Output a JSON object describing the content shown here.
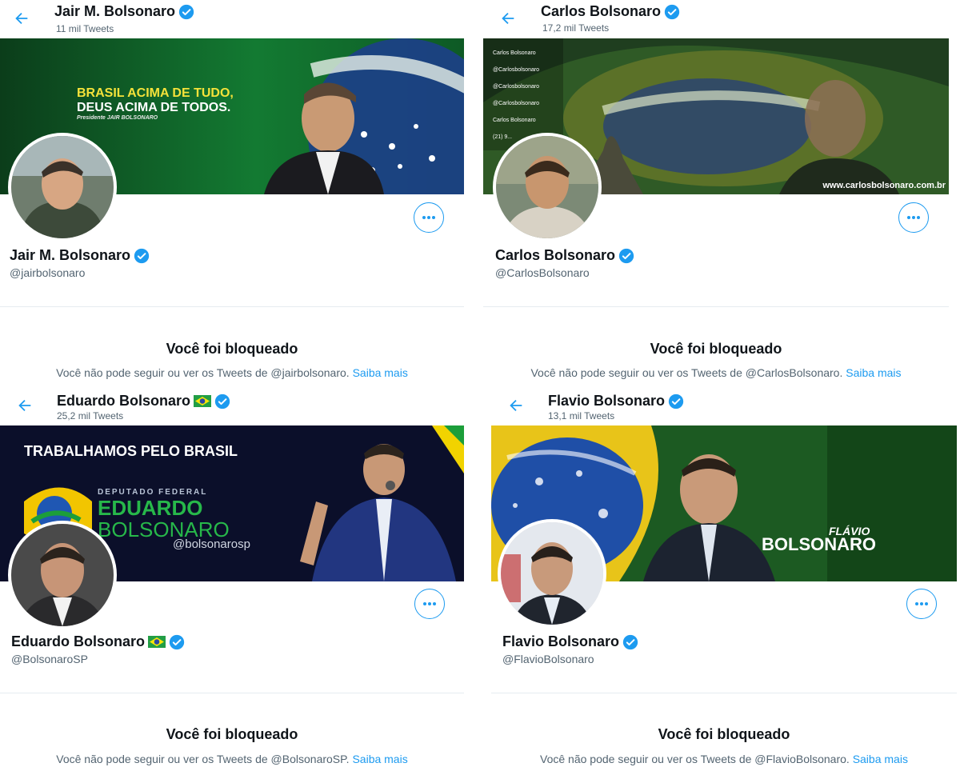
{
  "colors": {
    "accent": "#1d9bf0",
    "secondary_text": "#536471",
    "divider": "#e6ecf0"
  },
  "blocked": {
    "title": "Você foi bloqueado",
    "text_prefix": "Você não pode seguir ou ver os Tweets de ",
    "learn_more": "Saiba mais"
  },
  "profiles": [
    {
      "header_name": "Jair M. Bolsonaro",
      "tweet_count": "11 mil Tweets",
      "display_name": "Jair M. Bolsonaro",
      "handle": "@jairbolsonaro",
      "blocked_target": "@jairbolsonaro.",
      "flag": false,
      "banner": {
        "line1": "BRASIL ACIMA DE TUDO,",
        "line2": "DEUS ACIMA DE TODOS.",
        "line3": "Presidente JAIR BOLSONARO"
      }
    },
    {
      "header_name": "Carlos Bolsonaro",
      "tweet_count": "17,2 mil Tweets",
      "display_name": "Carlos Bolsonaro",
      "handle": "@CarlosBolsonaro",
      "blocked_target": "@CarlosBolsonaro.",
      "flag": false,
      "banner": {
        "social": [
          "Carlos Bolsonaro",
          "@Carlosbolsonaro",
          "@Carlosbolsonaro",
          "@Carlosbolsonaro",
          "Carlos Bolsonaro",
          "(21) 9..."
        ],
        "url": "www.carlosbolsonaro.com.br"
      }
    },
    {
      "header_name": "Eduardo Bolsonaro",
      "tweet_count": "25,2 mil Tweets",
      "display_name": "Eduardo Bolsonaro",
      "handle": "@BolsonaroSP",
      "blocked_target": "@BolsonaroSP.",
      "flag": true,
      "banner": {
        "headline": "TRABALHAMOS PELO BRASIL",
        "role": "DEPUTADO FEDERAL",
        "first": "EDUARDO",
        "last": "BOLSONARO",
        "social": "@bolsonarosp"
      }
    },
    {
      "header_name": "Flavio Bolsonaro",
      "tweet_count": "13,1 mil Tweets",
      "display_name": "Flavio Bolsonaro",
      "handle": "@FlavioBolsonaro",
      "blocked_target": "@FlavioBolsonaro.",
      "flag": false,
      "banner": {
        "first": "FLÁVIO",
        "last": "BOLSONARO"
      }
    }
  ]
}
